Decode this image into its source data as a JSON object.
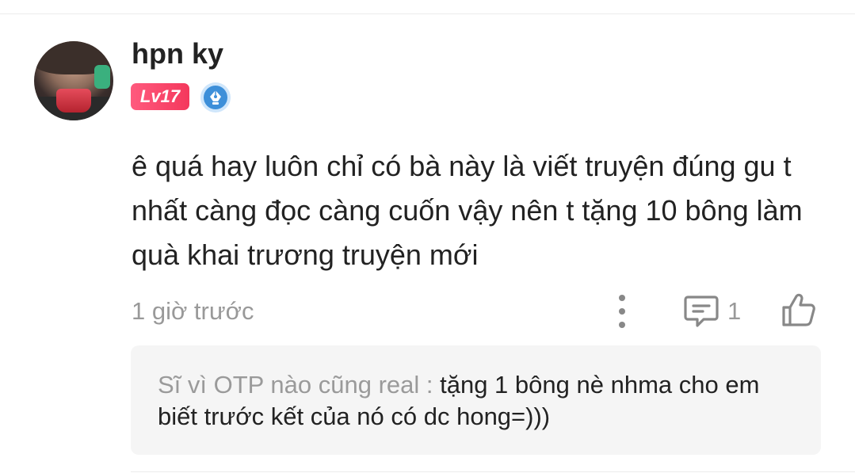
{
  "comment": {
    "username": "hpn ky",
    "level_badge": "Lv17",
    "text": "ê quá hay luôn chỉ có bà này là viết truyện đúng gu t nhất càng đọc càng cuốn vậy nên t tặng 10 bông làm quà khai trương truyện mới",
    "timestamp": "1 giờ trước",
    "reply_count": "1",
    "icons": {
      "more": "more-vertical-icon",
      "reply": "comment-icon",
      "like": "thumbs-up-icon",
      "badge": "pen-nib-icon"
    },
    "colors": {
      "level_badge": "#f4385c",
      "pen_badge": "#3d8fd9"
    }
  },
  "reply": {
    "author": "Sĩ vì OTP nào cũng real :",
    "text": " tặng 1 bông nè nhma cho em biết trước kết của nó có dc hong=)))"
  }
}
